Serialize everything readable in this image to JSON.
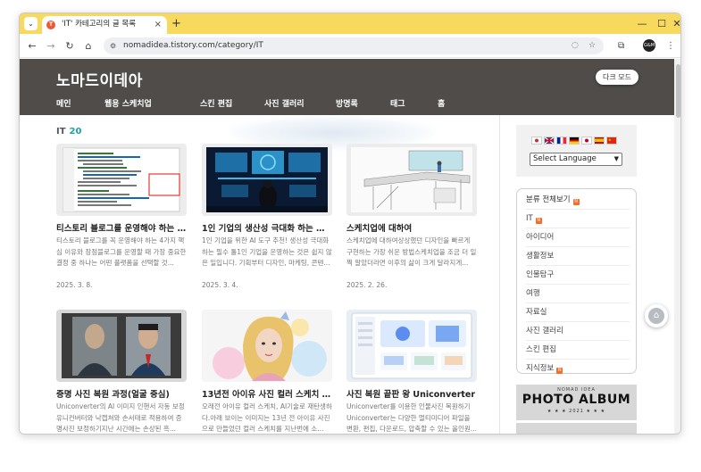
{
  "browser": {
    "tab_title": "'IT' 카테고리의 글 목록",
    "tab_close": "×",
    "new_tab": "+",
    "url": "nomadidea.tistory.com/category/IT",
    "profile_label": "G&M"
  },
  "header": {
    "blog_title": "노마드이데아",
    "dark_mode": "다크 모드",
    "nav": [
      "메인",
      "웹용 스케치업",
      "스킨 편집",
      "사진 갤러리",
      "방명록",
      "태그",
      "홈"
    ]
  },
  "category": {
    "name": "IT",
    "count": "20"
  },
  "posts": [
    {
      "title": "티스토리 블로그를 운영해야 하는 이...",
      "excerpt": "티스토리 블로그를 꼭 운영해야 하는 4가지 핵심 이유와 장점블로그를 운영할 때 가장 중요한 결정 중 하나는 어떤 플랫폼을 선택할 것...",
      "date": "2025. 3. 8."
    },
    {
      "title": "1인 기업의 생산성 극대화 하는 필수 ...",
      "excerpt": "1인 기업을 위한 AI 도구 추천! 생산성 극대화 하는 필수 툴1인 기업을 운영하는 것은 쉽지 않은 일입니다. 기획부터 디자인, 마케팅, 콘텐...",
      "date": "2025. 3. 4."
    },
    {
      "title": "스케치업에 대하여",
      "excerpt": "스케치업에 대하여상상했던 디자인을 빠르게 구현하는 가장 쉬운 방법스케치업을 조금 더 일찍 알았더라면 이후의 삶이 크게 달라지게...",
      "date": "2025. 2. 26."
    },
    {
      "title": "증명 사진 복원 과정(얼굴 중심)",
      "excerpt": "Uniconverter의 AI 이미지 인핸서 자동 보정 유니컨버터와 낙캡쳐와 손서태로 적용하여 증명사진 보정하기지난 시간에는 손상된 흑...",
      "date": ""
    },
    {
      "title": "13년전 아이유 사진 컬러 스케치 복원",
      "excerpt": "오래전 아이유 컬러 스케치, AI기술로 재탄생하다.아래 보이는 이미지는 13년 전 아이유 사진으로 만들었던 컬러 스케치를 지난번에 소...",
      "date": ""
    },
    {
      "title": "사진 복원 끝판 왕 Uniconverter",
      "excerpt": "Uniconverter를 이용한 인물사진 복원하기 Uniconverter는 다양한 멀티미디어 파일을 변환, 편집, 다운로드, 압축할 수 있는 올인원...",
      "date": ""
    }
  ],
  "sidebar": {
    "language_select": "Select Language",
    "category_header": "분류 전체보기",
    "categories": [
      "IT",
      "아이디어",
      "생활정보",
      "인물탐구",
      "여행",
      "자료실",
      "사진 갤러리",
      "스킨 편집",
      "지식정보"
    ],
    "album_sub": "NOMAD IDEA",
    "album_title": "PHOTO ALBUM",
    "album_year": "★ ★ ★  2021  ★ ★ ★"
  },
  "colors": {
    "tab_bar": "#f7d95e",
    "site_header": "#4f4c49",
    "accent_count": "#1aa3a8",
    "new_badge": "#f26c2a"
  }
}
